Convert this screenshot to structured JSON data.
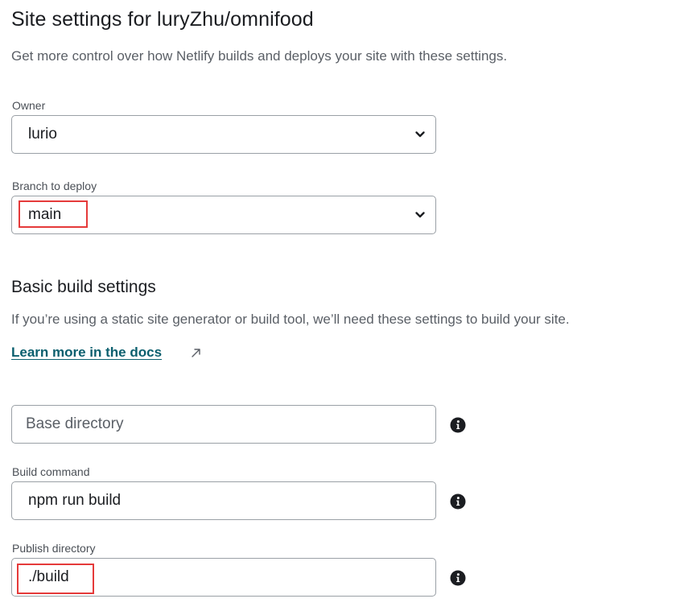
{
  "header": {
    "title": "Site settings for luryZhu/omnifood",
    "subtitle": "Get more control over how Netlify builds and deploys your site with these settings."
  },
  "owner": {
    "label": "Owner",
    "value": "lurio"
  },
  "branch": {
    "label": "Branch to deploy",
    "value": "main"
  },
  "build_settings": {
    "title": "Basic build settings",
    "description": "If you’re using a static site generator or build tool, we’ll need these settings to build your site.",
    "docs_link": "Learn more in the docs"
  },
  "base_directory": {
    "placeholder": "Base directory",
    "value": ""
  },
  "build_command": {
    "label": "Build command",
    "value": "npm run build"
  },
  "publish_directory": {
    "label": "Publish directory",
    "value": "./build"
  },
  "colors": {
    "link": "#0b5f6e",
    "highlight": "#e53a3a",
    "border": "#9aa0a6"
  }
}
